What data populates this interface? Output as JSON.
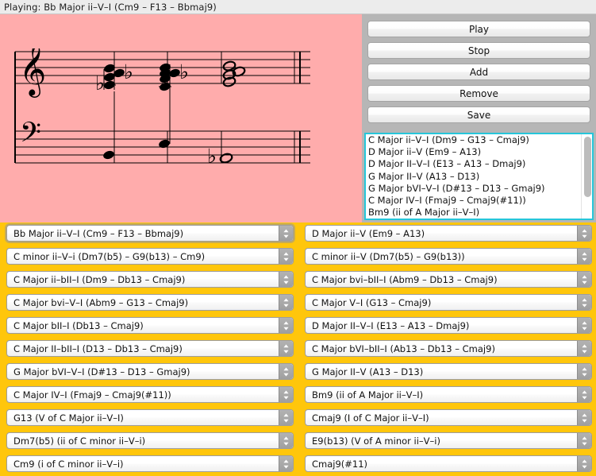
{
  "status": {
    "label": "Playing: Bb Major ii–V–I (Cm9 – F13 – Bbmaj9)"
  },
  "score": {
    "staff_name": "grand-staff-notation",
    "clefs": [
      "treble",
      "bass"
    ],
    "measures": 3,
    "chords": [
      "Cm9",
      "F13",
      "Bbmaj9"
    ],
    "background_color": "#ffacac"
  },
  "controls": {
    "buttons": [
      {
        "label": "Play",
        "name": "play-button"
      },
      {
        "label": "Stop",
        "name": "stop-button"
      },
      {
        "label": "Add",
        "name": "add-button"
      },
      {
        "label": "Remove",
        "name": "remove-button"
      },
      {
        "label": "Save",
        "name": "save-button"
      }
    ],
    "panel_color": "#b6b6b6"
  },
  "progression_list": {
    "focus_color": "#26c6da",
    "items": [
      "C Major ii–V–I (Dm9 – G13 – Cmaj9)",
      "D Major ii–V (Em9 – A13)",
      "D Major II–V–I (E13 – A13 – Dmaj9)",
      "G Major II–V (A13 – D13)",
      "G Major bVI–V–I (D#13 – D13 – Gmaj9)",
      "C Major IV–I (Fmaj9 – Cmaj9(#11))",
      "Bm9 (ii of A Major ii–V–I)"
    ]
  },
  "dropdowns": {
    "background_color": "#ffc60b",
    "left_column": [
      "Bb Major ii–V–I (Cm9 – F13 – Bbmaj9)",
      "C minor ii–V–i (Dm7(b5) – G9(b13) – Cm9)",
      "C Major ii–bII–I (Dm9 – Db13 – Cmaj9)",
      "C Major bvi–V–I (Abm9 – G13 – Cmaj9)",
      "C Major bII–I (Db13 – Cmaj9)",
      "C Major II–bII–I (D13 – Db13 – Cmaj9)",
      "G Major bVI–V–I (D#13 – D13 – Gmaj9)",
      "C Major IV–I (Fmaj9 – Cmaj9(#11))",
      "G13 (V of C Major ii–V–I)",
      "Dm7(b5) (ii of C minor ii–V–i)",
      "Cm9 (i of C minor ii–V–i)"
    ],
    "right_column": [
      "D Major ii–V (Em9 – A13)",
      "C minor ii–V (Dm7(b5) – G9(b13))",
      "C Major bvi–bII–I (Abm9 – Db13 – Cmaj9)",
      "C Major V–I (G13 – Cmaj9)",
      "D Major II–V–I (E13 – A13 – Dmaj9)",
      "C Major bVI–bII–I (Ab13 – Db13 – Cmaj9)",
      "G Major II–V (A13 – D13)",
      "Bm9 (ii of A Major ii–V–I)",
      "Cmaj9 (I of C Major ii–V–I)",
      "E9(b13) (V of A minor ii–V–i)",
      "Cmaj9(#11)"
    ]
  }
}
